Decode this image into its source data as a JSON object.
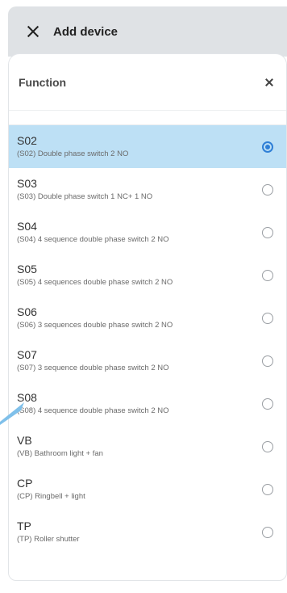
{
  "header": {
    "title": "Add device",
    "close_icon": "close-icon"
  },
  "sheet": {
    "title": "Function",
    "close_icon": "close-icon"
  },
  "accent_color": "#2f7fd6",
  "selected_bg": "#bde0f5",
  "options": [
    {
      "code": "S02",
      "desc": "(S02) Double phase switch 2 NO",
      "selected": true
    },
    {
      "code": "S03",
      "desc": "(S03) Double phase switch 1 NC+ 1 NO",
      "selected": false
    },
    {
      "code": "S04",
      "desc": "(S04) 4 sequence double phase switch 2 NO",
      "selected": false
    },
    {
      "code": "S05",
      "desc": "(S05) 4 sequences double phase switch 2 NO",
      "selected": false
    },
    {
      "code": "S06",
      "desc": "(S06) 3 sequences double phase switch 2 NO",
      "selected": false
    },
    {
      "code": "S07",
      "desc": "(S07) 3 sequence double phase switch 2 NO",
      "selected": false
    },
    {
      "code": "S08",
      "desc": "(S08) 4 sequence double phase switch 2 NO",
      "selected": false
    },
    {
      "code": "VB",
      "desc": "(VB) Bathroom light + fan",
      "selected": false
    },
    {
      "code": "CP",
      "desc": "(CP) Ringbell + light",
      "selected": false
    },
    {
      "code": "TP",
      "desc": "(TP) Roller shutter",
      "selected": false
    }
  ]
}
